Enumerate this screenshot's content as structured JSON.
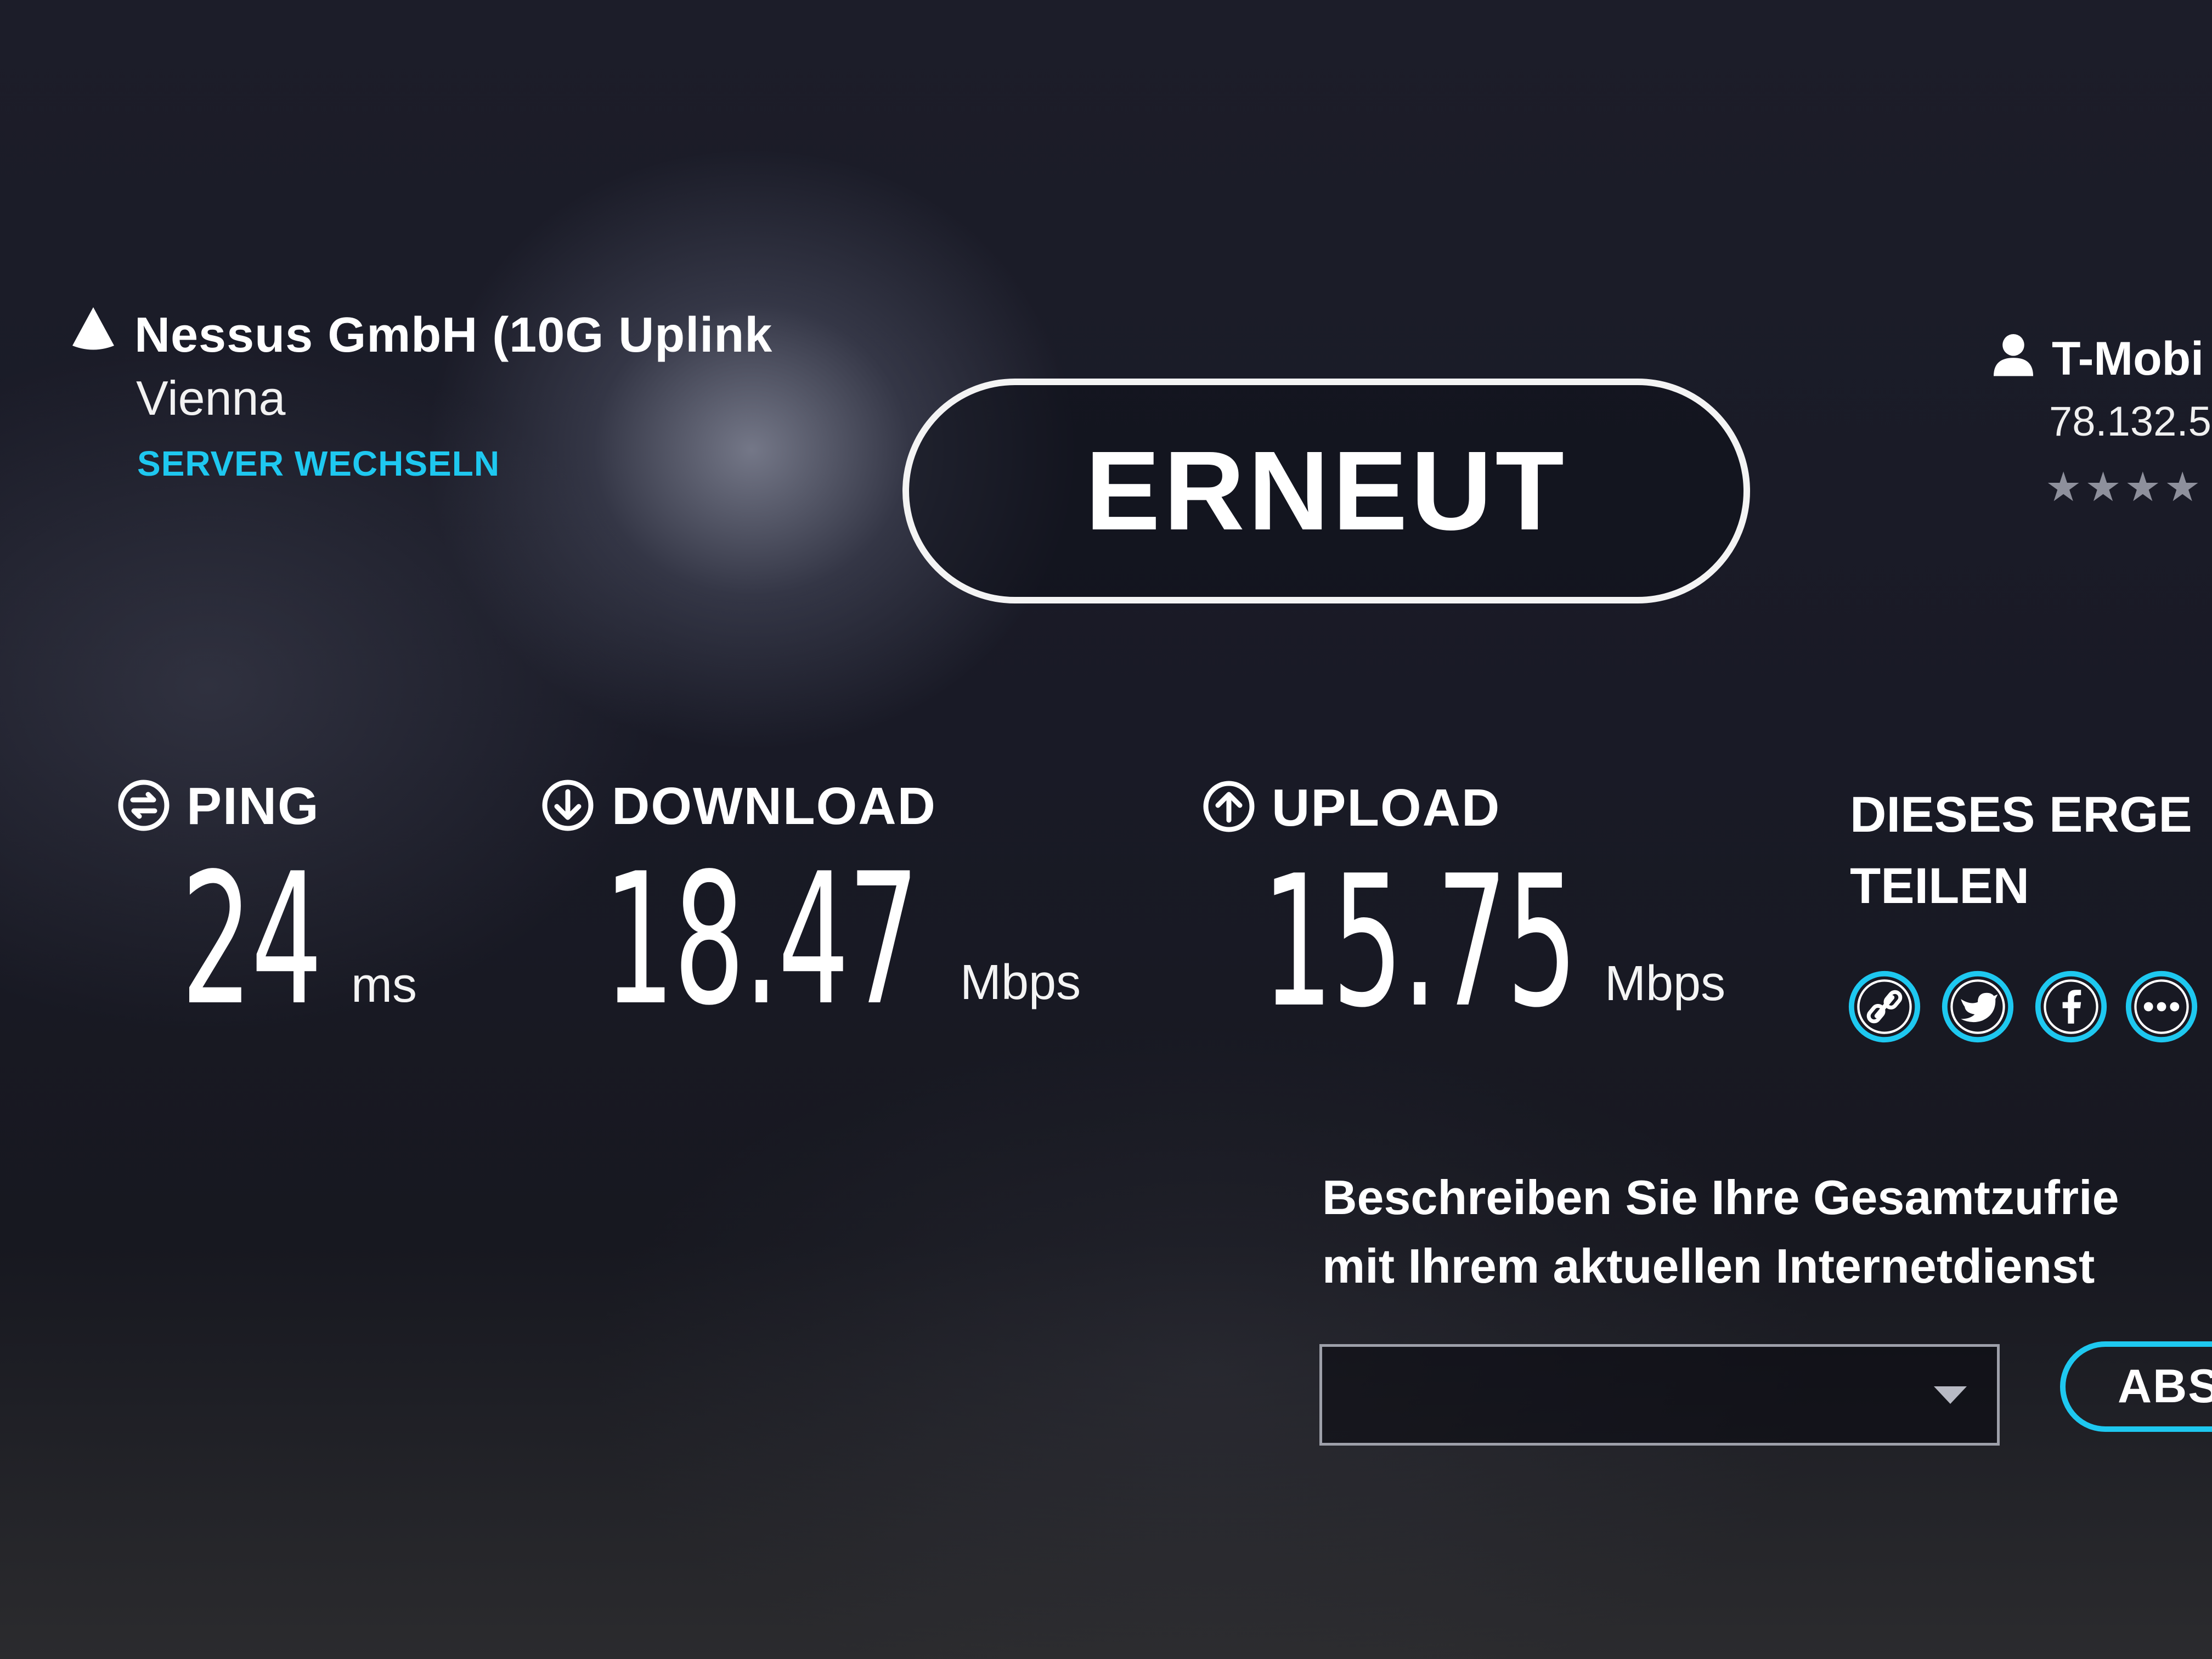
{
  "server": {
    "name": "Nessus GmbH (10G Uplink",
    "city": "Vienna",
    "change_label": "SERVER WECHSELN",
    "icon": "server-icon"
  },
  "again_button": {
    "label": "ERNEUT"
  },
  "provider": {
    "name": "T-Mobi",
    "ip": "78.132.5",
    "rating_stars": "★★★★",
    "icon": "user-icon"
  },
  "metrics": {
    "ping": {
      "label": "PING",
      "value": "24",
      "unit": "ms",
      "icon": "ping-icon"
    },
    "download": {
      "label": "DOWNLOAD",
      "value": "18.47",
      "unit": "Mbps",
      "icon": "download-icon"
    },
    "upload": {
      "label": "UPLOAD",
      "value": "15.75",
      "unit": "Mbps",
      "icon": "upload-icon"
    }
  },
  "share": {
    "title_line1": "DIESES ERGE",
    "title_line2": "TEILEN",
    "icons": [
      "link-icon",
      "twitter-icon",
      "facebook-icon",
      "more-icon"
    ]
  },
  "survey": {
    "question_line1": "Beschreiben Sie Ihre Gesamtzufrie",
    "question_line2": "mit Ihrem aktuellen Internetdienst",
    "select_value": "",
    "submit_label": "ABS"
  },
  "colors": {
    "accent": "#1ec8f0",
    "text": "#ffffff",
    "background": "#191a26"
  }
}
